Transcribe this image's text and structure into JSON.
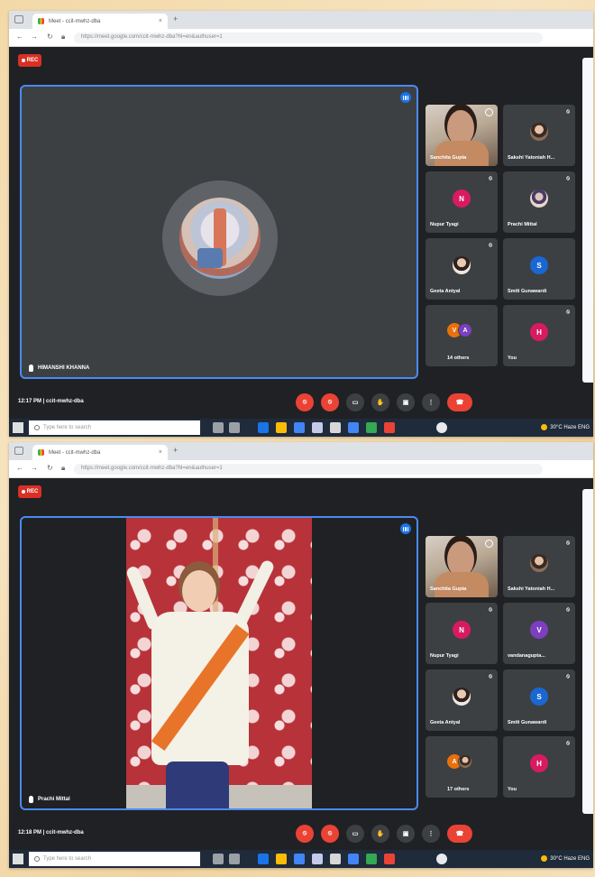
{
  "screenshots": [
    {
      "browser": {
        "tab_title": "Meet - ccit-mwhz-dba",
        "url_text": "https://meet.google.com/ccit-mwhz-dba?hl=en&authuser=1"
      },
      "meeting": {
        "rec_label": "REC",
        "main_tile_name": "HIMANSHI KHANNA",
        "participants": [
          {
            "name": "Sanchita Gupta",
            "kind": "self"
          },
          {
            "name": "Sakshi Yatoniah H...",
            "kind": "photo"
          },
          {
            "name": "Nupur Tyagi",
            "kind": "initial",
            "initial": "N",
            "color": "#d81b60"
          },
          {
            "name": "Prachi Mittal",
            "kind": "photo"
          },
          {
            "name": "Geeta Antyal",
            "kind": "photo"
          },
          {
            "name": "Smiti Gunawardi",
            "kind": "initial",
            "initial": "S",
            "color": "#1967d2"
          },
          {
            "name": "14 others",
            "kind": "others"
          },
          {
            "name": "You",
            "kind": "initial",
            "initial": "H",
            "color": "#d81b60"
          }
        ],
        "time_code": "12:17 PM | ccit-mwhz-dba"
      },
      "taskbar": {
        "search_placeholder": "Type here to search",
        "tray_text": "30°C  Haze  ENG"
      }
    },
    {
      "browser": {
        "tab_title": "Meet - ccit-mwhz-dba",
        "url_text": "https://meet.google.com/ccit-mwhz-dba?hl=en&authuser=1"
      },
      "meeting": {
        "rec_label": "REC",
        "main_tile_name": "Prachi Mittal",
        "participants": [
          {
            "name": "Sanchita Gupta",
            "kind": "self"
          },
          {
            "name": "Sakshi Yatoniah H...",
            "kind": "photo"
          },
          {
            "name": "Nupur Tyagi",
            "kind": "initial",
            "initial": "N",
            "color": "#d81b60"
          },
          {
            "name": "vandanagupta...",
            "kind": "initial",
            "initial": "V",
            "color": "#7b3fbf"
          },
          {
            "name": "Geeta Antyal",
            "kind": "photo"
          },
          {
            "name": "Smiti Gunawardi",
            "kind": "initial",
            "initial": "S",
            "color": "#1967d2"
          },
          {
            "name": "17 others",
            "kind": "others"
          },
          {
            "name": "You",
            "kind": "initial",
            "initial": "H",
            "color": "#d81b60"
          }
        ],
        "time_code": "12:18 PM | ccit-mwhz-dba"
      },
      "taskbar": {
        "search_placeholder": "Type here to search",
        "tray_text": "30°C  Haze  ENG"
      }
    }
  ],
  "controls": {
    "mic_off": "⦸",
    "cam_off": "⦸",
    "captions": "▭",
    "raise_hand": "✋",
    "present": "▣",
    "more": "⋮",
    "end_call": "☎"
  },
  "colors": {
    "meet_bg": "#202124",
    "tile_bg": "#3c4043",
    "accent_blue": "#4a8af4",
    "danger_red": "#ea4335"
  }
}
